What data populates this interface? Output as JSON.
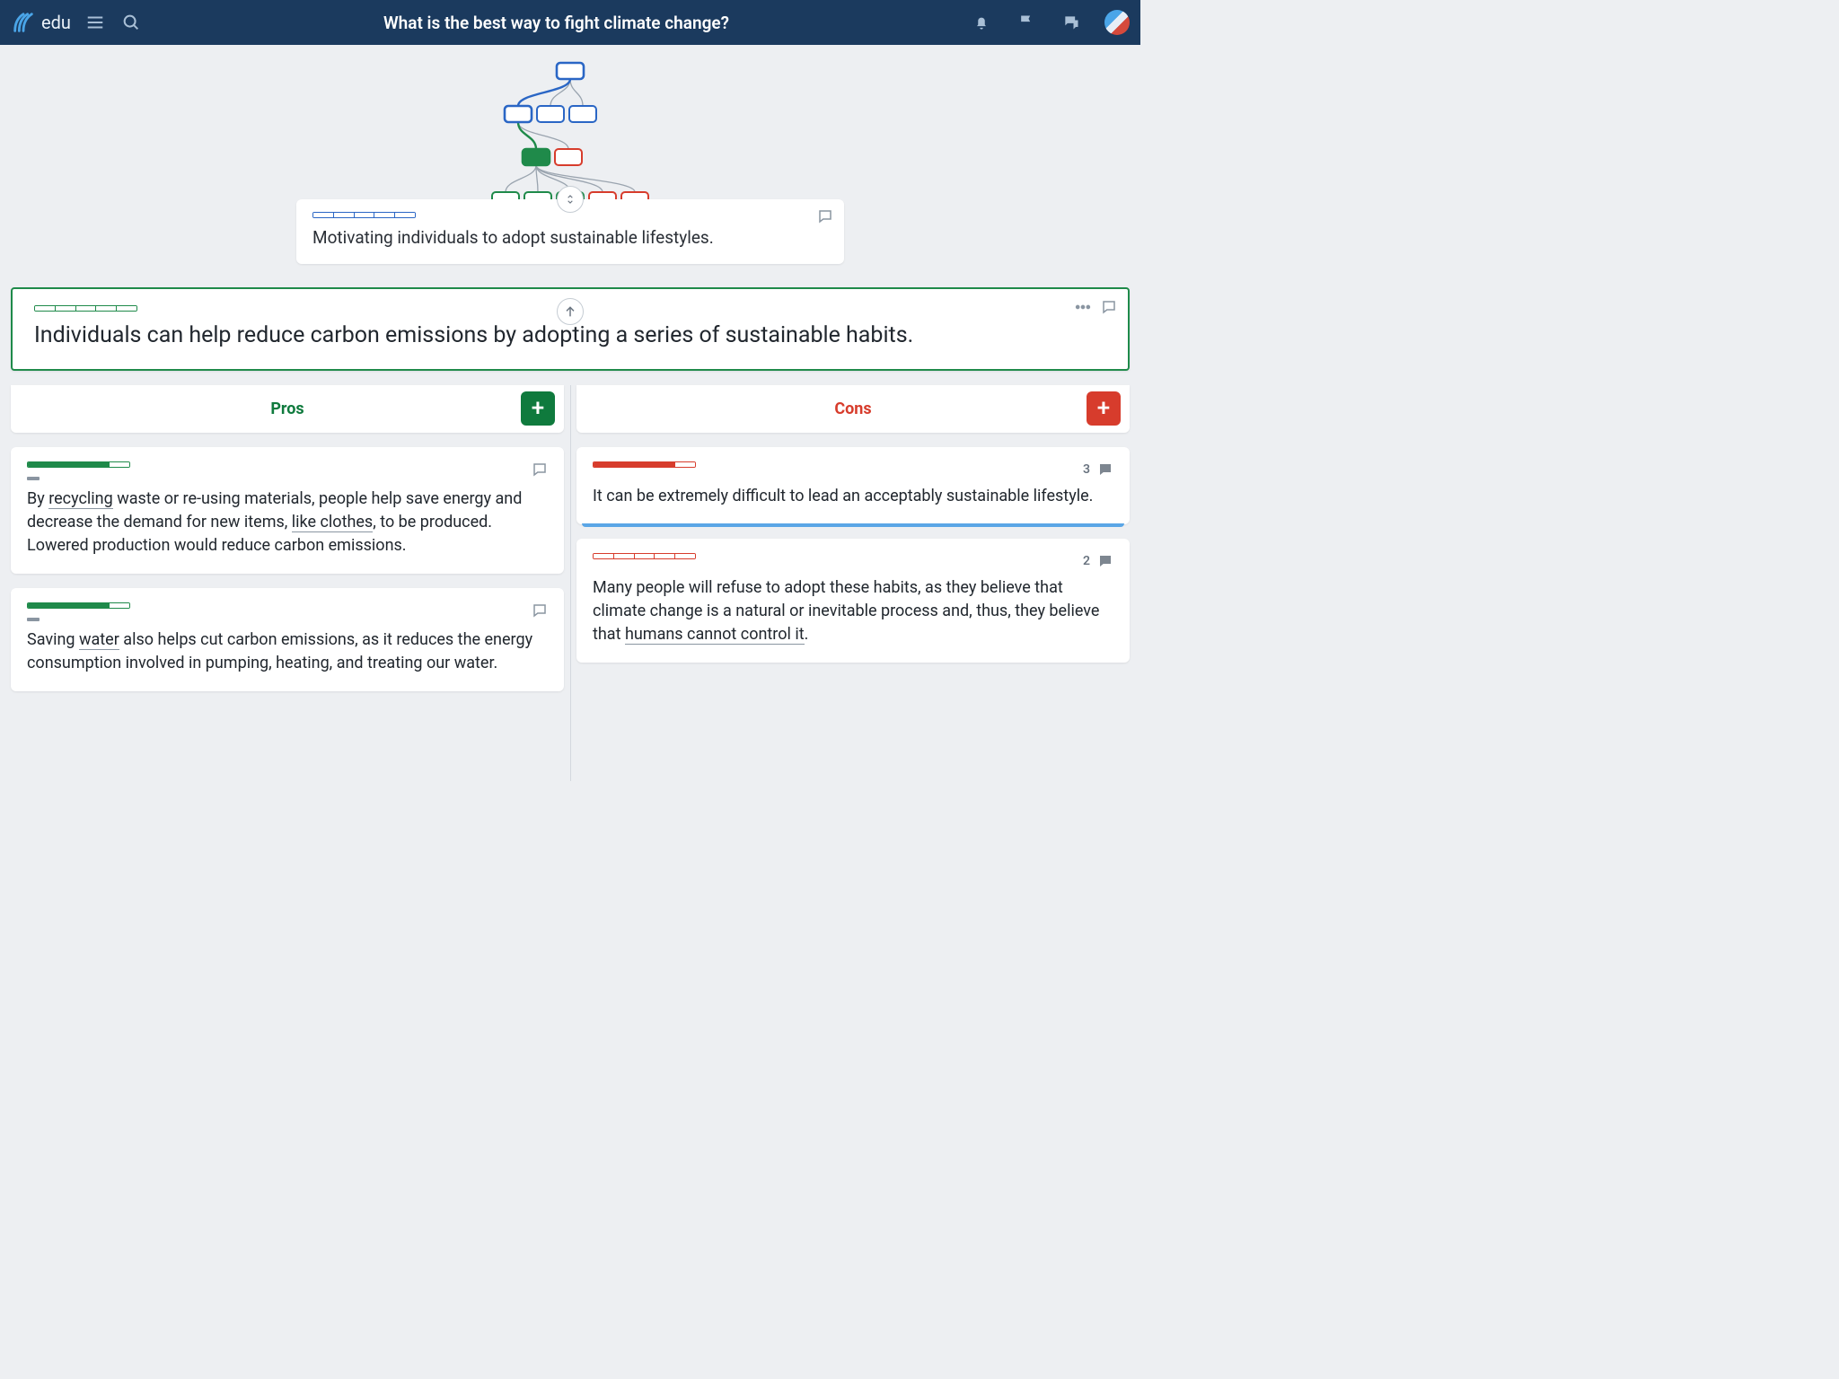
{
  "header": {
    "brand": "edu",
    "title": "What is the best way to fight climate change?"
  },
  "tree": {
    "levels": [
      [
        {
          "color": "blue",
          "filled": true
        }
      ],
      [
        {
          "color": "blue",
          "filled": true
        },
        {
          "color": "blue"
        },
        {
          "color": "blue"
        }
      ],
      [
        {
          "color": "green",
          "filled": true
        },
        {
          "color": "red"
        }
      ],
      [
        {
          "color": "green"
        },
        {
          "color": "green"
        },
        {
          "color": "green"
        },
        {
          "color": "red"
        },
        {
          "color": "red"
        }
      ]
    ]
  },
  "parent": {
    "text": "Motivating individuals to adopt sustainable lifestyles."
  },
  "claim": {
    "text": "Individuals can help reduce carbon emissions by adopting a series of sustainable habits."
  },
  "columns": {
    "pros_label": "Pros",
    "cons_label": "Cons"
  },
  "pros": [
    {
      "text_html": "By <u>recycling</u> waste or re-using materials, people help save energy and decrease the demand for new items, <u>like clothes</u>, to be produced. Lowered production would reduce carbon emissions.",
      "comments": 0
    },
    {
      "text_html": "Saving <u>water</u> also helps cut carbon emissions, as it reduces the energy consumption involved in pumping, heating, and treating our water.",
      "comments": 0
    }
  ],
  "cons": [
    {
      "text_html": "It can be extremely difficult to lead an acceptably sustainable lifestyle.",
      "comments": 3,
      "highlight": true
    },
    {
      "text_html": "Many people will refuse to adopt these habits, as they believe that climate change is a natural or inevitable process and, thus, they believe that <u>humans cannot control it</u>.",
      "comments": 2
    }
  ]
}
